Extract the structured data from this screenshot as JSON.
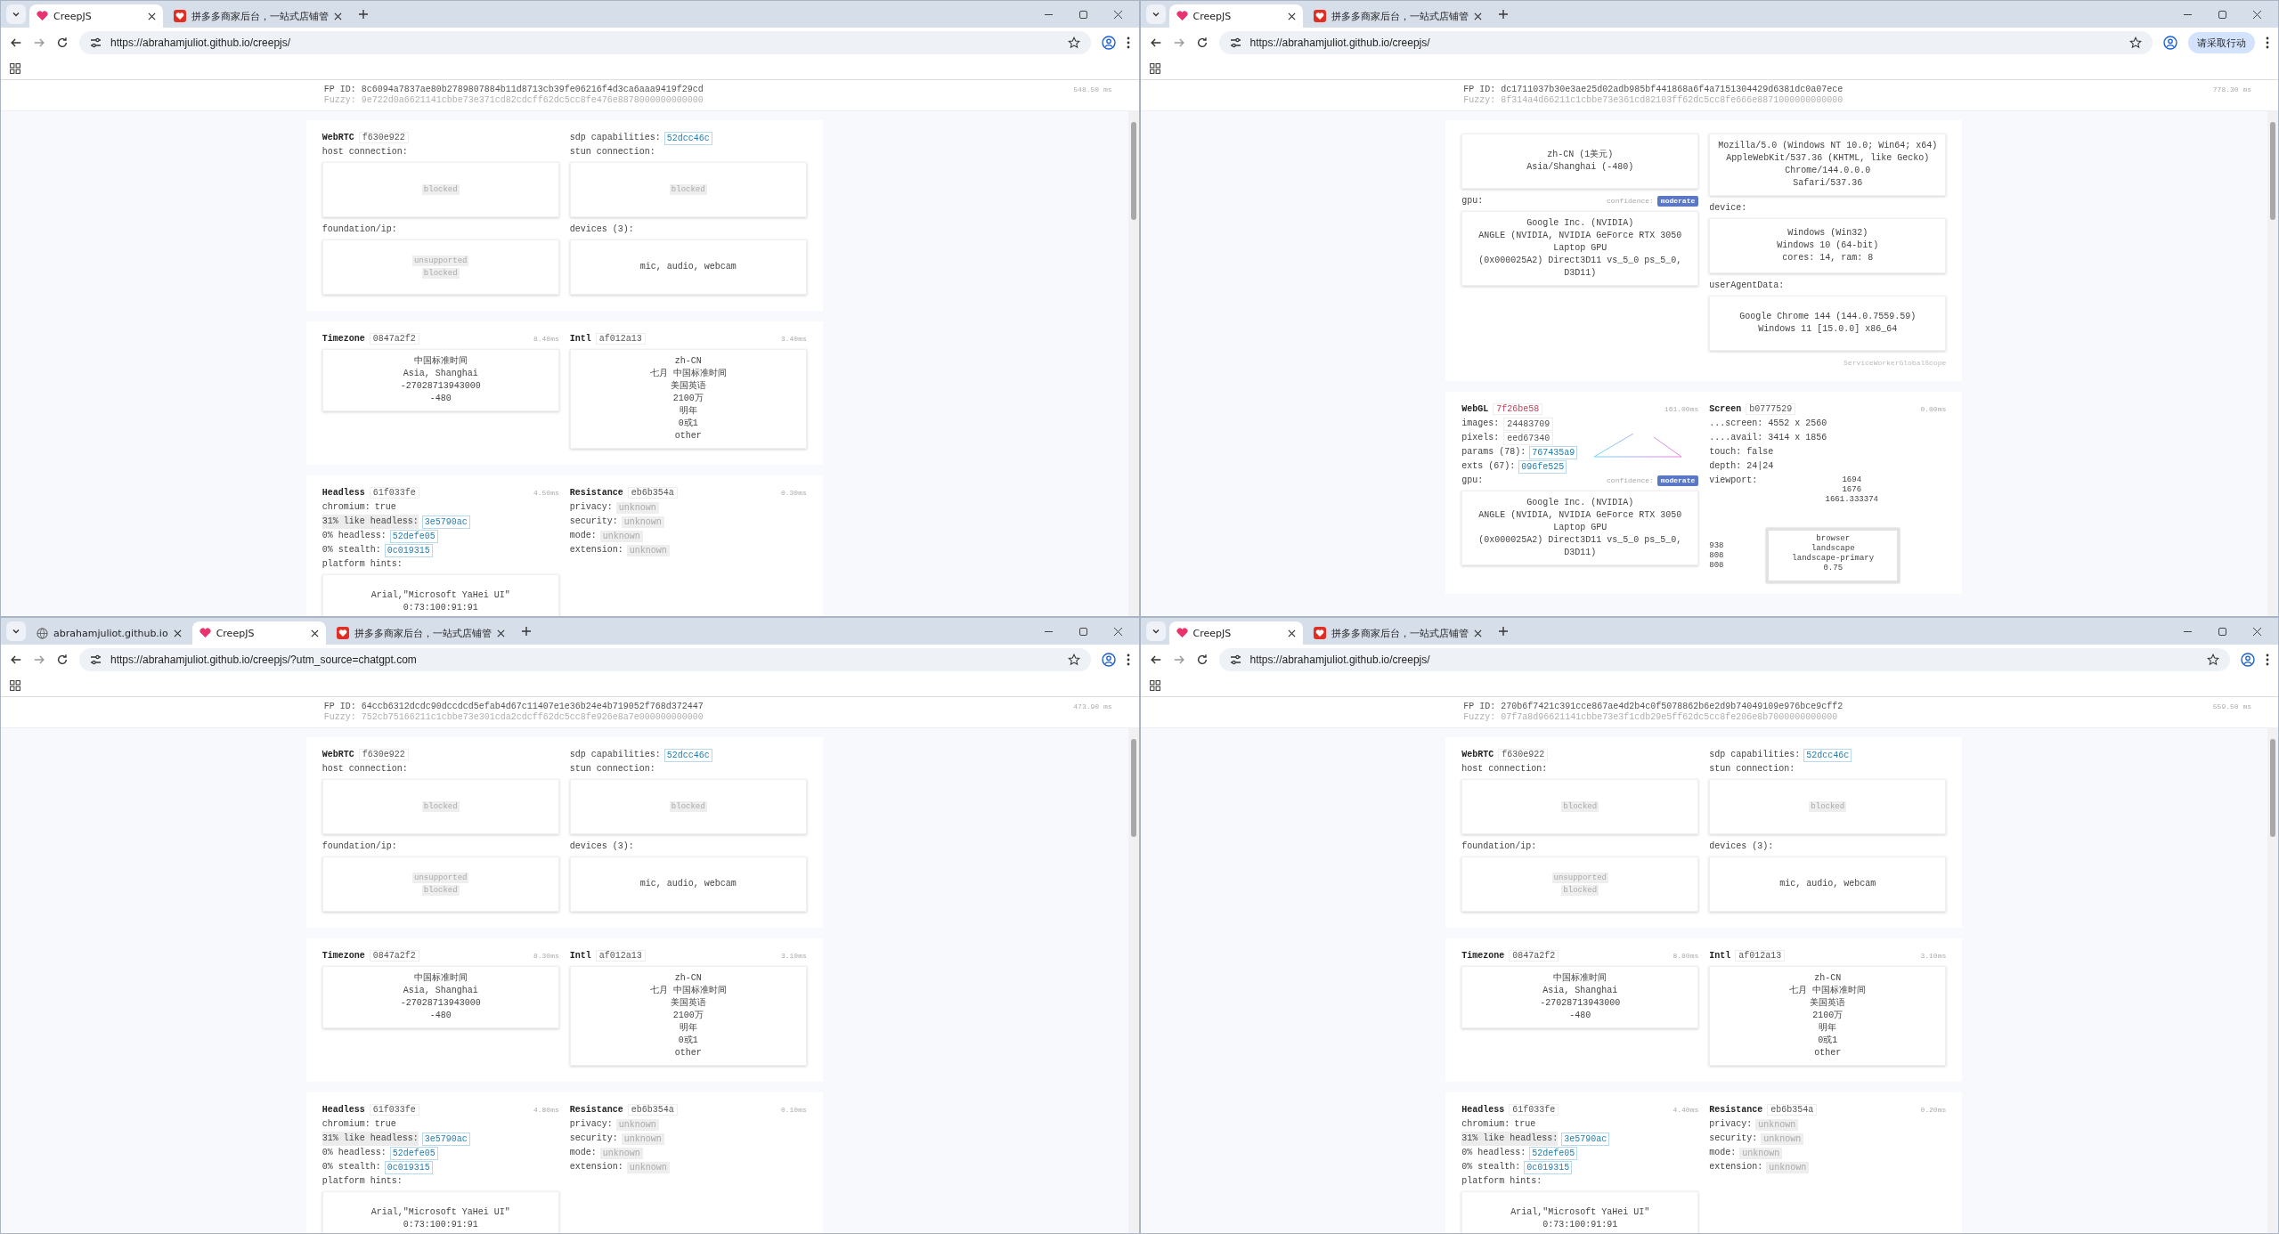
{
  "windows": [
    {
      "tabs": [
        {
          "title": "CreepJS",
          "kind": "creep",
          "selected": true
        },
        {
          "title": "拼多多商家后台，一站式店铺管",
          "kind": "pdd",
          "selected": false
        }
      ],
      "url": "https://abrahamjuliot.github.io/creepjs/",
      "fp_id": "FP ID: 8c6094a7837ae80b2789807884b11d8713cb39fe06216f4d3ca6aaa9419f29cd",
      "fuzzy": "Fuzzy: 9e722d0a6621141cbbe73e371cd82cdcff62dc5cc8fe476e8878000000000000",
      "time": "548.50 ms",
      "cards": [
        {
          "columns": [
            [
              {
                "kind": "heading",
                "title": "WebRTC",
                "hash": "f630e922"
              },
              {
                "kind": "label",
                "text": "host connection:"
              },
              {
                "kind": "box",
                "lines": [
                  {
                    "text": "blocked",
                    "chip": true
                  }
                ]
              },
              {
                "kind": "label",
                "text": "foundation/ip:"
              },
              {
                "kind": "box",
                "lines": [
                  {
                    "text": "unsupported",
                    "chip": true
                  },
                  {
                    "text": "blocked",
                    "chip": true
                  }
                ]
              }
            ],
            [
              {
                "kind": "pair_link",
                "label": "sdp capabilities:",
                "value": "52dcc46c"
              },
              {
                "kind": "label",
                "text": "stun connection:"
              },
              {
                "kind": "box",
                "lines": [
                  {
                    "text": "blocked",
                    "chip": true
                  }
                ]
              },
              {
                "kind": "label",
                "text": "devices (3):"
              },
              {
                "kind": "box",
                "lines": [
                  {
                    "text": "mic, audio, webcam",
                    "chip": false
                  }
                ]
              }
            ]
          ]
        },
        {
          "columns": [
            [
              {
                "kind": "heading",
                "title": "Timezone",
                "hash": "0847a2f2",
                "time": "8.40ms"
              },
              {
                "kind": "box",
                "lines": [
                  {
                    "text": "中国标准时间",
                    "chip": false
                  },
                  {
                    "text": "Asia, Shanghai",
                    "chip": false
                  },
                  {
                    "text": "-27028713943000",
                    "chip": false
                  },
                  {
                    "text": "-480",
                    "chip": false
                  }
                ]
              }
            ],
            [
              {
                "kind": "heading",
                "title": "Intl",
                "hash": "af012a13",
                "time": "3.40ms"
              },
              {
                "kind": "box",
                "lines": [
                  {
                    "text": "zh-CN",
                    "chip": false
                  },
                  {
                    "text": "七月 中国标准时间",
                    "chip": false
                  },
                  {
                    "text": "美国英语",
                    "chip": false
                  },
                  {
                    "text": "2100万",
                    "chip": false
                  },
                  {
                    "text": "明年",
                    "chip": false
                  },
                  {
                    "text": "0或1",
                    "chip": false
                  },
                  {
                    "text": "other",
                    "chip": false
                  }
                ]
              }
            ]
          ]
        },
        {
          "columns": [
            [
              {
                "kind": "heading",
                "title": "Headless",
                "hash": "61f033fe",
                "time": "4.50ms"
              },
              {
                "kind": "pair_plain",
                "label": "chromium:",
                "value": "true"
              },
              {
                "kind": "pair_marked_link",
                "label": "31% like headless:",
                "value": "3e5790ac"
              },
              {
                "kind": "pair_link",
                "label": "0% headless:",
                "value": "52defe05"
              },
              {
                "kind": "pair_link",
                "label": "0% stealth:",
                "value": "0c019315"
              },
              {
                "kind": "label",
                "text": "platform hints:"
              },
              {
                "kind": "box",
                "lines": [
                  {
                    "text": "Arial,\"Microsoft YaHei UI\"",
                    "chip": false
                  },
                  {
                    "text": "0:73:100:91:91",
                    "chip": false
                  }
                ]
              }
            ],
            [
              {
                "kind": "heading",
                "title": "Resistance",
                "hash": "eb6b354a",
                "time": "0.30ms"
              },
              {
                "kind": "pair_chip",
                "label": "privacy:",
                "value": "unknown"
              },
              {
                "kind": "pair_chip",
                "label": "security:",
                "value": "unknown"
              },
              {
                "kind": "pair_chip",
                "label": "mode:",
                "value": "unknown"
              },
              {
                "kind": "pair_chip",
                "label": "extension:",
                "value": "unknown"
              }
            ]
          ]
        }
      ]
    },
    {
      "tabs": [
        {
          "title": "CreepJS",
          "kind": "creep",
          "selected": true
        },
        {
          "title": "拼多多商家后台，一站式店铺管",
          "kind": "pdd",
          "selected": false
        }
      ],
      "url": "https://abrahamjuliot.github.io/creepjs/",
      "action": "请采取行动",
      "fp_id": "FP ID: dc1711037b30e3ae25d02adb985bf441868a6f4a7151304429d6381dc0a07ece",
      "fuzzy": "Fuzzy: 8f314a4d66211c1cbbe73e361cd82103ff62dc5cc8fe666e8871000000000000",
      "time": "778.30 ms",
      "cards": [
        {
          "columns": [
            [
              {
                "kind": "box",
                "lines": [
                  {
                    "text": "zh-CN (1美元)",
                    "chip": false
                  },
                  {
                    "text": "Asia/Shanghai (-480)",
                    "chip": false
                  }
                ]
              },
              {
                "kind": "confidence",
                "label": "gpu:",
                "note": "confidence:",
                "badge": "moderate"
              },
              {
                "kind": "box",
                "lines": [
                  {
                    "text": "Google Inc. (NVIDIA)",
                    "chip": false
                  },
                  {
                    "text": "ANGLE (NVIDIA, NVIDIA GeForce RTX 3050 Laptop GPU",
                    "chip": false
                  },
                  {
                    "text": "(0x000025A2) Direct3D11 vs_5_0 ps_5_0, D3D11)",
                    "chip": false
                  }
                ]
              }
            ],
            [
              {
                "kind": "box",
                "lines": [
                  {
                    "text": "Mozilla/5.0 (Windows NT 10.0; Win64; x64)",
                    "chip": false
                  },
                  {
                    "text": "AppleWebKit/537.36 (KHTML, like Gecko) Chrome/144.0.0.0",
                    "chip": false
                  },
                  {
                    "text": "Safari/537.36",
                    "chip": false
                  }
                ]
              },
              {
                "kind": "label",
                "text": "device:"
              },
              {
                "kind": "box",
                "lines": [
                  {
                    "text": "Windows (Win32)",
                    "chip": false
                  },
                  {
                    "text": "Windows 10 (64-bit)",
                    "chip": false
                  },
                  {
                    "text": "cores: 14, ram: 8",
                    "chip": false
                  }
                ]
              },
              {
                "kind": "label",
                "text": "userAgentData:"
              },
              {
                "kind": "box",
                "lines": [
                  {
                    "text": "Google Chrome 144 (144.0.7559.59)",
                    "chip": false
                  },
                  {
                    "text": "Windows 11 [15.0.0] x86_64",
                    "chip": false
                  }
                ]
              },
              {
                "kind": "note",
                "text": "ServiceWorkerGlobalScope"
              }
            ]
          ]
        },
        {
          "columns": [
            [
              {
                "kind": "heading_alert",
                "title": "WebGL",
                "hash": "7f26be58",
                "time": "161.00ms"
              },
              {
                "kind": "figure_group",
                "rows": [
                  {
                    "kind": "pair_hash",
                    "label": "images:",
                    "value": "24483709"
                  },
                  {
                    "kind": "pair_hash",
                    "label": "pixels:",
                    "value": "eed67340"
                  },
                  {
                    "kind": "pair_link",
                    "label": "params (78):",
                    "value": "767435a9"
                  },
                  {
                    "kind": "pair_link",
                    "label": "exts (67):",
                    "value": "096fe525"
                  }
                ]
              },
              {
                "kind": "confidence",
                "label": "gpu:",
                "note": "confidence:",
                "badge": "moderate"
              },
              {
                "kind": "box",
                "lines": [
                  {
                    "text": "Google Inc. (NVIDIA)",
                    "chip": false
                  },
                  {
                    "text": "ANGLE (NVIDIA, NVIDIA GeForce RTX 3050 Laptop GPU",
                    "chip": false
                  },
                  {
                    "text": "(0x000025A2) Direct3D11 vs_5_0 ps_5_0, D3D11)",
                    "chip": false
                  }
                ]
              }
            ],
            [
              {
                "kind": "heading",
                "title": "Screen",
                "hash": "b0777529",
                "time": "0.00ms"
              },
              {
                "kind": "text",
                "text": "...screen: 4552 x 2560"
              },
              {
                "kind": "text",
                "text": "....avail: 3414 x 1856"
              },
              {
                "kind": "text",
                "text": "touch: false"
              },
              {
                "kind": "text",
                "text": "depth: 24|24"
              },
              {
                "kind": "viewport",
                "label": "viewport:",
                "values": [
                  "1694",
                  "1676",
                  "1661.333374"
                ]
              },
              {
                "kind": "screen_frame",
                "side": [
                  "938",
                  "808",
                  "808"
                ],
                "lines": [
                  "browser",
                  "landscape",
                  "landscape-primary",
                  "0.75"
                ]
              }
            ]
          ]
        }
      ]
    },
    {
      "tabs": [
        {
          "title": "abrahamjuliot.github.io",
          "kind": "globe",
          "selected": false
        },
        {
          "title": "CreepJS",
          "kind": "creep",
          "selected": true
        },
        {
          "title": "拼多多商家后台，一站式店铺管",
          "kind": "pdd",
          "selected": false
        }
      ],
      "url": "https://abrahamjuliot.github.io/creepjs/?utm_source=chatgpt.com",
      "fp_id": "FP ID: 64ccb6312dcdc90dccdcd5efab4d67c11407e1e36b24e4b719052f768d372447",
      "fuzzy": "Fuzzy: 752cb75166211c1cbbe73e301cda2cdcff62dc5cc8fe926e8a7e000000000000",
      "time": "473.90 ms",
      "cards": [
        {
          "columns": [
            [
              {
                "kind": "heading",
                "title": "WebRTC",
                "hash": "f630e922"
              },
              {
                "kind": "label",
                "text": "host connection:"
              },
              {
                "kind": "box",
                "lines": [
                  {
                    "text": "blocked",
                    "chip": true
                  }
                ]
              },
              {
                "kind": "label",
                "text": "foundation/ip:"
              },
              {
                "kind": "box",
                "lines": [
                  {
                    "text": "unsupported",
                    "chip": true
                  },
                  {
                    "text": "blocked",
                    "chip": true
                  }
                ]
              }
            ],
            [
              {
                "kind": "pair_link",
                "label": "sdp capabilities:",
                "value": "52dcc46c"
              },
              {
                "kind": "label",
                "text": "stun connection:"
              },
              {
                "kind": "box",
                "lines": [
                  {
                    "text": "blocked",
                    "chip": true
                  }
                ]
              },
              {
                "kind": "label",
                "text": "devices (3):"
              },
              {
                "kind": "box",
                "lines": [
                  {
                    "text": "mic, audio, webcam",
                    "chip": false
                  }
                ]
              }
            ]
          ]
        },
        {
          "columns": [
            [
              {
                "kind": "heading",
                "title": "Timezone",
                "hash": "0847a2f2",
                "time": "8.30ms"
              },
              {
                "kind": "box",
                "lines": [
                  {
                    "text": "中国标准时间",
                    "chip": false
                  },
                  {
                    "text": "Asia, Shanghai",
                    "chip": false
                  },
                  {
                    "text": "-27028713943000",
                    "chip": false
                  },
                  {
                    "text": "-480",
                    "chip": false
                  }
                ]
              }
            ],
            [
              {
                "kind": "heading",
                "title": "Intl",
                "hash": "af012a13",
                "time": "3.10ms"
              },
              {
                "kind": "box",
                "lines": [
                  {
                    "text": "zh-CN",
                    "chip": false
                  },
                  {
                    "text": "七月 中国标准时间",
                    "chip": false
                  },
                  {
                    "text": "美国英语",
                    "chip": false
                  },
                  {
                    "text": "2100万",
                    "chip": false
                  },
                  {
                    "text": "明年",
                    "chip": false
                  },
                  {
                    "text": "0或1",
                    "chip": false
                  },
                  {
                    "text": "other",
                    "chip": false
                  }
                ]
              }
            ]
          ]
        },
        {
          "columns": [
            [
              {
                "kind": "heading",
                "title": "Headless",
                "hash": "61f033fe",
                "time": "4.80ms"
              },
              {
                "kind": "pair_plain",
                "label": "chromium:",
                "value": "true"
              },
              {
                "kind": "pair_marked_link",
                "label": "31% like headless:",
                "value": "3e5790ac"
              },
              {
                "kind": "pair_link",
                "label": "0% headless:",
                "value": "52defe05"
              },
              {
                "kind": "pair_link",
                "label": "0% stealth:",
                "value": "0c019315"
              },
              {
                "kind": "label",
                "text": "platform hints:"
              },
              {
                "kind": "box",
                "lines": [
                  {
                    "text": "Arial,\"Microsoft YaHei UI\"",
                    "chip": false
                  },
                  {
                    "text": "0:73:100:91:91",
                    "chip": false
                  }
                ]
              }
            ],
            [
              {
                "kind": "heading",
                "title": "Resistance",
                "hash": "eb6b354a",
                "time": "0.10ms"
              },
              {
                "kind": "pair_chip",
                "label": "privacy:",
                "value": "unknown"
              },
              {
                "kind": "pair_chip",
                "label": "security:",
                "value": "unknown"
              },
              {
                "kind": "pair_chip",
                "label": "mode:",
                "value": "unknown"
              },
              {
                "kind": "pair_chip",
                "label": "extension:",
                "value": "unknown"
              }
            ]
          ]
        }
      ]
    },
    {
      "tabs": [
        {
          "title": "CreepJS",
          "kind": "creep",
          "selected": true
        },
        {
          "title": "拼多多商家后台，一站式店铺管",
          "kind": "pdd",
          "selected": false
        }
      ],
      "url": "https://abrahamjuliot.github.io/creepjs/",
      "fp_id": "FP ID: 270b6f7421c391cce867ae4d2b4c0f5078862b6e2d9b74049109e976bce9cff2",
      "fuzzy": "Fuzzy: 07f7a8d96621141cbbe73e3f1cdb29e5ff62dc5cc8fe206e8b7000000000000",
      "time": "559.50 ms",
      "cards": [
        {
          "columns": [
            [
              {
                "kind": "heading",
                "title": "WebRTC",
                "hash": "f630e922"
              },
              {
                "kind": "label",
                "text": "host connection:"
              },
              {
                "kind": "box",
                "lines": [
                  {
                    "text": "blocked",
                    "chip": true
                  }
                ]
              },
              {
                "kind": "label",
                "text": "foundation/ip:"
              },
              {
                "kind": "box",
                "lines": [
                  {
                    "text": "unsupported",
                    "chip": true
                  },
                  {
                    "text": "blocked",
                    "chip": true
                  }
                ]
              }
            ],
            [
              {
                "kind": "pair_link",
                "label": "sdp capabilities:",
                "value": "52dcc46c"
              },
              {
                "kind": "label",
                "text": "stun connection:"
              },
              {
                "kind": "box",
                "lines": [
                  {
                    "text": "blocked",
                    "chip": true
                  }
                ]
              },
              {
                "kind": "label",
                "text": "devices (3):"
              },
              {
                "kind": "box",
                "lines": [
                  {
                    "text": "mic, audio, webcam",
                    "chip": false
                  }
                ]
              }
            ]
          ]
        },
        {
          "columns": [
            [
              {
                "kind": "heading",
                "title": "Timezone",
                "hash": "0847a2f2",
                "time": "8.80ms"
              },
              {
                "kind": "box",
                "lines": [
                  {
                    "text": "中国标准时间",
                    "chip": false
                  },
                  {
                    "text": "Asia, Shanghai",
                    "chip": false
                  },
                  {
                    "text": "-27028713943000",
                    "chip": false
                  },
                  {
                    "text": "-480",
                    "chip": false
                  }
                ]
              }
            ],
            [
              {
                "kind": "heading",
                "title": "Intl",
                "hash": "af012a13",
                "time": "3.10ms"
              },
              {
                "kind": "box",
                "lines": [
                  {
                    "text": "zh-CN",
                    "chip": false
                  },
                  {
                    "text": "七月 中国标准时间",
                    "chip": false
                  },
                  {
                    "text": "美国英语",
                    "chip": false
                  },
                  {
                    "text": "2100万",
                    "chip": false
                  },
                  {
                    "text": "明年",
                    "chip": false
                  },
                  {
                    "text": "0或1",
                    "chip": false
                  },
                  {
                    "text": "other",
                    "chip": false
                  }
                ]
              }
            ]
          ]
        },
        {
          "columns": [
            [
              {
                "kind": "heading",
                "title": "Headless",
                "hash": "61f033fe",
                "time": "4.40ms"
              },
              {
                "kind": "pair_plain",
                "label": "chromium:",
                "value": "true"
              },
              {
                "kind": "pair_marked_link",
                "label": "31% like headless:",
                "value": "3e5790ac"
              },
              {
                "kind": "pair_link",
                "label": "0% headless:",
                "value": "52defe05"
              },
              {
                "kind": "pair_link",
                "label": "0% stealth:",
                "value": "0c019315"
              },
              {
                "kind": "label",
                "text": "platform hints:"
              },
              {
                "kind": "box",
                "lines": [
                  {
                    "text": "Arial,\"Microsoft YaHei UI\"",
                    "chip": false
                  },
                  {
                    "text": "0:73:100:91:91",
                    "chip": false
                  }
                ]
              }
            ],
            [
              {
                "kind": "heading",
                "title": "Resistance",
                "hash": "eb6b354a",
                "time": "0.20ms"
              },
              {
                "kind": "pair_chip",
                "label": "privacy:",
                "value": "unknown"
              },
              {
                "kind": "pair_chip",
                "label": "security:",
                "value": "unknown"
              },
              {
                "kind": "pair_chip",
                "label": "mode:",
                "value": "unknown"
              },
              {
                "kind": "pair_chip",
                "label": "extension:",
                "value": "unknown"
              }
            ]
          ]
        }
      ]
    }
  ]
}
